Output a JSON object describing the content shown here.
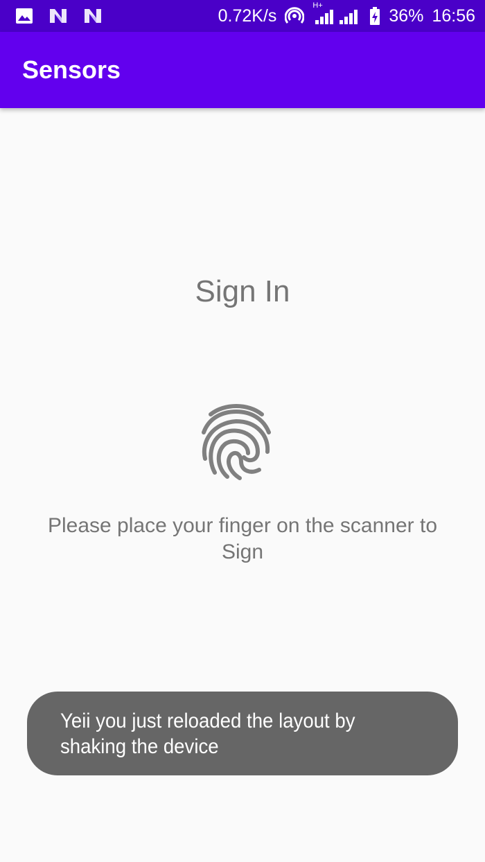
{
  "status_bar": {
    "icons_left": [
      "image-icon",
      "n-notification-icon",
      "n-notification-icon"
    ],
    "network_speed": "0.72K/s",
    "network_type": "H+",
    "battery": "36%",
    "time": "16:56"
  },
  "app_bar": {
    "title": "Sensors"
  },
  "main": {
    "title": "Sign In",
    "instruction": "Please place your finger on the scanner to Sign"
  },
  "toast": {
    "message": "Yeii you just reloaded the layout by shaking the device"
  },
  "colors": {
    "status_bar": "#4a00c8",
    "app_bar": "#6200ee",
    "background": "#fafafa",
    "text_grey": "#757575",
    "toast": "#666666"
  }
}
